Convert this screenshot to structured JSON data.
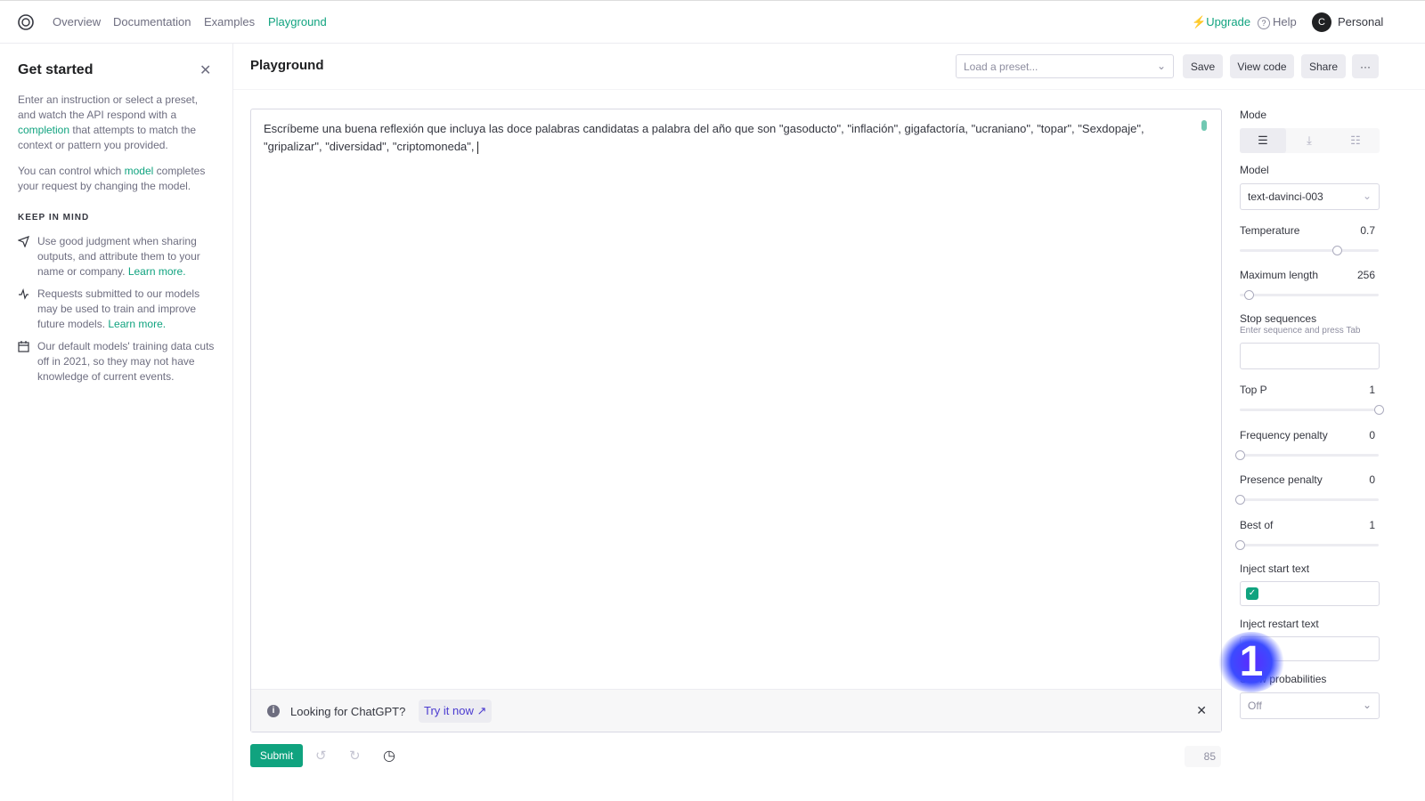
{
  "nav": {
    "items": [
      "Overview",
      "Documentation",
      "Examples",
      "Playground"
    ],
    "active": "Playground",
    "upgrade": "Upgrade",
    "help": "Help",
    "avatar_initial": "C",
    "account": "Personal"
  },
  "sidebar": {
    "title": "Get started",
    "intro_1a": "Enter an instruction or select a preset, and watch the API respond with a ",
    "intro_1_link": "completion",
    "intro_1b": " that attempts to match the context or pattern you provided.",
    "intro_2a": "You can control which ",
    "intro_2_link": "model",
    "intro_2b": " completes your request by changing the model.",
    "keep_in_mind": "KEEP IN MIND",
    "items": [
      {
        "icon": "send-icon",
        "text": "Use good judgment when sharing outputs, and attribute them to your name or company. ",
        "link": "Learn more."
      },
      {
        "icon": "activity-icon",
        "text": "Requests submitted to our models may be used to train and improve future models. ",
        "link": "Learn more."
      },
      {
        "icon": "calendar-icon",
        "text": "Our default models' training data cuts off in 2021, so they may not have knowledge of current events.",
        "link": ""
      }
    ]
  },
  "header": {
    "title": "Playground",
    "preset_placeholder": "Load a preset...",
    "save": "Save",
    "view_code": "View code",
    "share": "Share",
    "more": "···"
  },
  "editor": {
    "prompt": "Escríbeme una buena reflexión que incluya las doce palabras candidatas a palabra del año que son \"gasoducto\", \"inflación\", gigafactoría, \"ucraniano\", \"topar\", \"Sexdopaje\", \"gripalizar\", \"diversidad\", \"criptomoneda\", ",
    "banner_text": "Looking for ChatGPT?",
    "banner_link": "Try it now"
  },
  "footer": {
    "submit": "Submit",
    "token_count": "85"
  },
  "settings": {
    "mode_label": "Mode",
    "model_label": "Model",
    "model_value": "text-davinci-003",
    "temperature": {
      "label": "Temperature",
      "value": 0.7,
      "min": 0,
      "max": 1,
      "display": "0.7"
    },
    "max_length": {
      "label": "Maximum length",
      "value": 256,
      "min": 1,
      "max": 4000,
      "display": "256"
    },
    "stop_label": "Stop sequences",
    "stop_hint": "Enter sequence and press Tab",
    "top_p": {
      "label": "Top P",
      "value": 1,
      "min": 0,
      "max": 1,
      "display": "1"
    },
    "frequency": {
      "label": "Frequency penalty",
      "value": 0,
      "min": 0,
      "max": 2,
      "display": "0"
    },
    "presence": {
      "label": "Presence penalty",
      "value": 0,
      "min": 0,
      "max": 2,
      "display": "0"
    },
    "best_of": {
      "label": "Best of",
      "value": 1,
      "min": 1,
      "max": 20,
      "display": "1"
    },
    "inject_start": "Inject start text",
    "inject_start_checked": true,
    "inject_restart": "Inject restart text",
    "inject_restart_checked": true,
    "probabilities_label": "Show probabilities",
    "probabilities_value": "Off"
  },
  "overlay": {
    "marker": "1"
  },
  "colors": {
    "accent": "#10a37f",
    "marker": "#5b2bff"
  }
}
